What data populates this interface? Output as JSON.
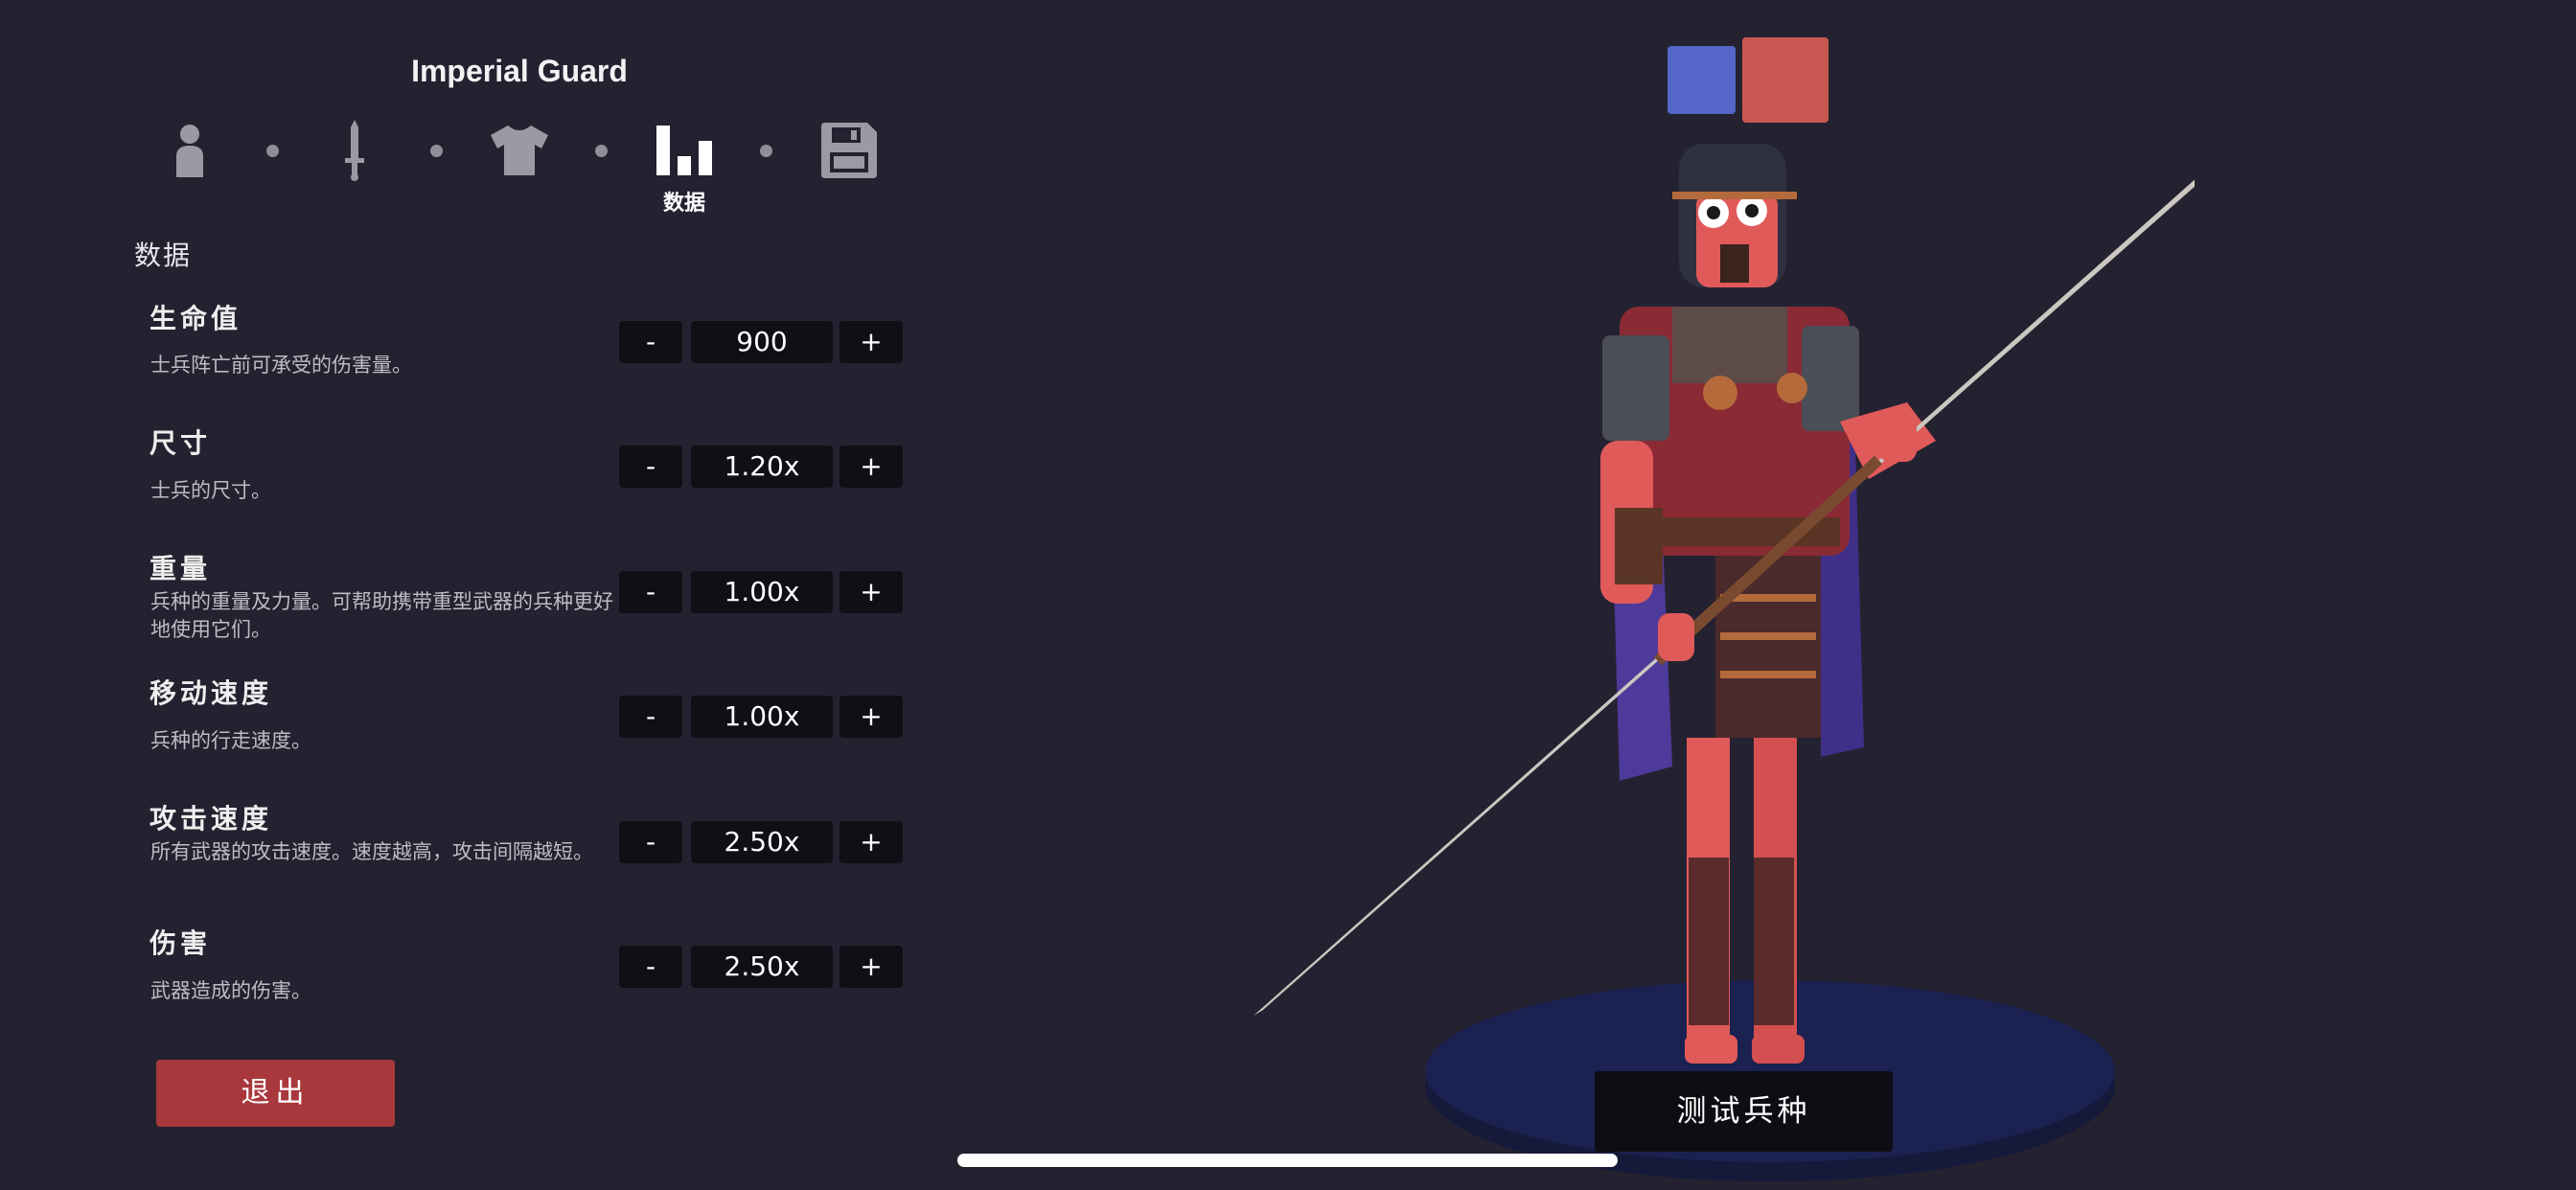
{
  "title": "Imperial Guard",
  "steps": {
    "active_label": "数据",
    "icons": [
      "person-icon",
      "sword-icon",
      "shirt-icon",
      "stats-icon",
      "save-icon"
    ]
  },
  "section_title": "数据",
  "stats": [
    {
      "name": "生命值",
      "desc": "士兵阵亡前可承受的伤害量。",
      "value": "900"
    },
    {
      "name": "尺寸",
      "desc": "士兵的尺寸。",
      "value": "1.20x"
    },
    {
      "name": "重量",
      "desc": "兵种的重量及力量。可帮助携带重型武器的兵种更好地使用它们。",
      "value": "1.00x"
    },
    {
      "name": "移动速度",
      "desc": "兵种的行走速度。",
      "value": "1.00x"
    },
    {
      "name": "攻击速度",
      "desc": "所有武器的攻击速度。速度越高，攻击间隔越短。",
      "value": "2.50x"
    },
    {
      "name": "伤害",
      "desc": "武器造成的伤害。",
      "value": "2.50x"
    }
  ],
  "controls": {
    "minus": "-",
    "plus": "+"
  },
  "exit_label": "退出",
  "test_label": "测试兵种",
  "team_colors": {
    "blue": "#5466c9",
    "red": "#c95852"
  }
}
